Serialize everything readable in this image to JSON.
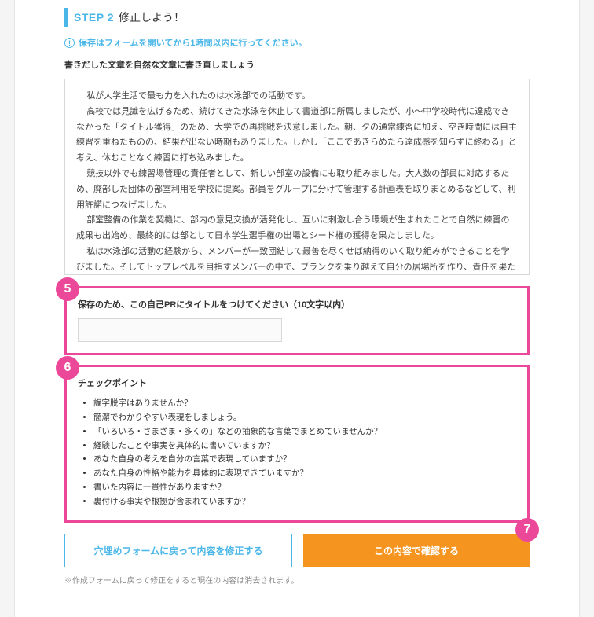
{
  "step": {
    "label": "STEP 2",
    "title": "修正しよう！"
  },
  "notice": "保存はフォームを開いてから1時間以内に行ってください。",
  "instruction": "書きだした文章を自然な文章に書き直しましょう",
  "essay": {
    "p1": "私が大学生活で最も力を入れたのは水泳部での活動です。",
    "p2": "高校では見識を広げるため、続けてきた水泳を休止して書道部に所属しましたが、小～中学校時代に達成できなかった「タイトル獲得」のため、大学での再挑戦を決意しました。朝、夕の通常練習に加え、空き時間には自主練習を重ねたものの、結果が出ない時期もありました。しかし「ここであきらめたら達成感を知らずに終わる」と考え、休むことなく練習に打ち込みました。",
    "p3": "競技以外でも練習場管理の責任者として、新しい部室の設備にも取り組みました。大人数の部員に対応するため、廃部した団体の部室利用を学校に提案。部員をグループに分けて管理する計画表を取りまとめるなどして、利用許諾につなげました。",
    "p4": "部室整備の作業を契機に、部内の意見交換が活発化し、互いに刺激し合う環境が生まれたことで自然に練習の成果も出始め、最終的には部として日本学生選手権の出場とシード権の獲得を果たしました。",
    "p5": "私は水泳部の活動の経験から、メンバーが一致団結して最善を尽くせば納得のいく取り組みができることを学びました。そしてトップレベルを目指すメンバーの中で、ブランクを乗り越えて自分の居場所を作り、責任を果たせたことが大きな自信になっています。"
  },
  "titleSection": {
    "badge": "5",
    "label": "保存のため、この自己PRにタイトルをつけてください（10文字以内）",
    "placeholder": ""
  },
  "checkSection": {
    "badge": "6",
    "title": "チェックポイント",
    "items": [
      "誤字脱字はありませんか？",
      "簡潔でわかりやすい表現をしましょう。",
      "「いろいろ・さまざま・多くの」などの抽象的な言葉でまとめていませんか？",
      "経験したことや事実を具体的に書いていますか？",
      "あなた自身の考えを自分の言葉で表現していますか？",
      "あなた自身の性格や能力を具体的に表現できていますか？",
      "書いた内容に一貫性がありますか？",
      "裏付ける事実や根拠が含まれていますか？"
    ]
  },
  "actions": {
    "back": "穴埋めフォームに戻って内容を修正する",
    "confirm": "この内容で確認する",
    "badge": "7"
  },
  "footnote": "※作成フォームに戻って修正をすると現在の内容は消去されます。"
}
